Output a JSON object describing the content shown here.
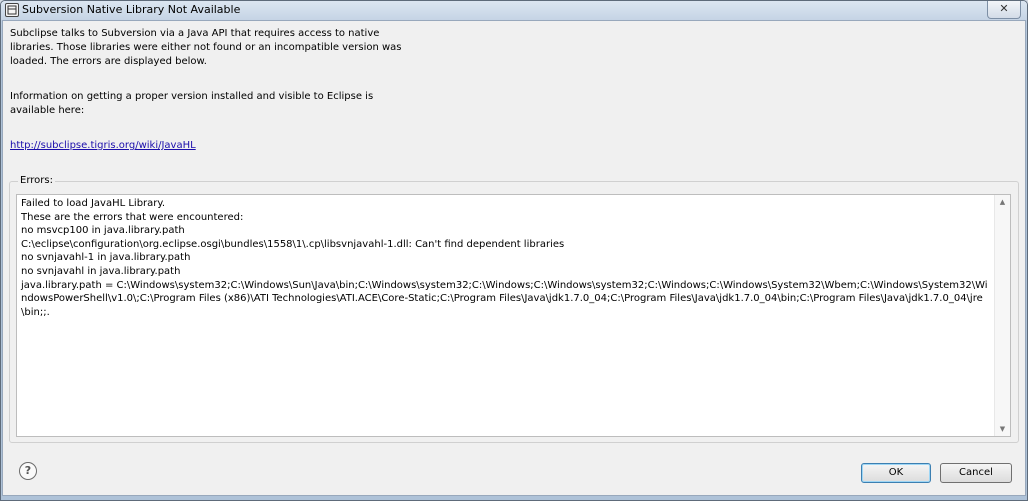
{
  "window": {
    "title": "Subversion Native Library Not Available",
    "close_label": "✕"
  },
  "message": {
    "paragraph1": "Subclipse talks to Subversion via a Java API that requires access to native libraries.  Those libraries were either not found or an incompatible version was loaded.  The errors are displayed below.",
    "paragraph2": "Information on getting a proper version installed and visible to Eclipse is available here:",
    "link": "http://subclipse.tigris.org/wiki/JavaHL"
  },
  "errors": {
    "label": "Errors:",
    "text": "Failed to load JavaHL Library.\nThese are the errors that were encountered:\nno msvcp100 in java.library.path\nC:\\eclipse\\configuration\\org.eclipse.osgi\\bundles\\1558\\1\\.cp\\libsvnjavahl-1.dll: Can't find dependent libraries\nno svnjavahl-1 in java.library.path\nno svnjavahl in java.library.path\njava.library.path = C:\\Windows\\system32;C:\\Windows\\Sun\\Java\\bin;C:\\Windows\\system32;C:\\Windows;C:\\Windows\\system32;C:\\Windows;C:\\Windows\\System32\\Wbem;C:\\Windows\\System32\\WindowsPowerShell\\v1.0\\;C:\\Program Files (x86)\\ATI Technologies\\ATI.ACE\\Core-Static;C:\\Program Files\\Java\\jdk1.7.0_04;C:\\Program Files\\Java\\jdk1.7.0_04\\bin;C:\\Program Files\\Java\\jdk1.7.0_04\\jre\\bin;;."
  },
  "icons": {
    "window": "eclipse-dialog-icon",
    "help": "help-icon",
    "scroll_up": "scroll-up-arrow-icon",
    "scroll_down": "scroll-down-arrow-icon"
  },
  "buttons": {
    "ok": "OK",
    "cancel": "Cancel",
    "help": "?"
  },
  "colors": {
    "link": "#1a0dab",
    "default_button_border": "#3c7fb1"
  }
}
